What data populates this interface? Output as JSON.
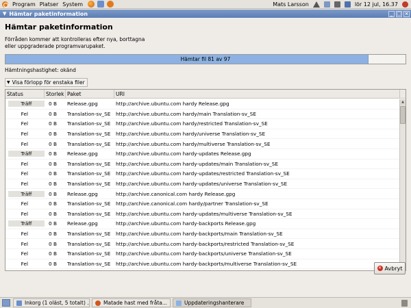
{
  "top_panel": {
    "menus": [
      "Program",
      "Platser",
      "System"
    ],
    "user": "Mats Larsson",
    "datetime": "lör 12 jul, 16.37"
  },
  "window": {
    "title": "Hämtar paketinformation",
    "heading": "Hämtar paketinformation",
    "description_line1": "Förråden kommer att kontrolleras efter nya, borttagna",
    "description_line2": "eller uppgraderade programvarupaket.",
    "progress_text": "Hämtar fil 81 av 97",
    "progress_fraction": 0.908,
    "speed": "Hämtningshastighet: okänd",
    "expander": "Visa förlopp för enstaka filer",
    "cancel": "Avbryt"
  },
  "table": {
    "headers": [
      "Status",
      "Storlek",
      "Paket",
      "URI"
    ],
    "rows": [
      {
        "status": "Träff",
        "size": "0 B",
        "pkg": "Release.gpg",
        "uri": "http://archive.ubuntu.com hardy Release.gpg"
      },
      {
        "status": "Fel",
        "size": "0 B",
        "pkg": "Translation-sv_SE",
        "uri": "http://archive.ubuntu.com hardy/main Translation-sv_SE"
      },
      {
        "status": "Fel",
        "size": "0 B",
        "pkg": "Translation-sv_SE",
        "uri": "http://archive.ubuntu.com hardy/restricted Translation-sv_SE"
      },
      {
        "status": "Fel",
        "size": "0 B",
        "pkg": "Translation-sv_SE",
        "uri": "http://archive.ubuntu.com hardy/universe Translation-sv_SE"
      },
      {
        "status": "Fel",
        "size": "0 B",
        "pkg": "Translation-sv_SE",
        "uri": "http://archive.ubuntu.com hardy/multiverse Translation-sv_SE"
      },
      {
        "status": "Träff",
        "size": "0 B",
        "pkg": "Release.gpg",
        "uri": "http://archive.ubuntu.com hardy-updates Release.gpg"
      },
      {
        "status": "Fel",
        "size": "0 B",
        "pkg": "Translation-sv_SE",
        "uri": "http://archive.ubuntu.com hardy-updates/main Translation-sv_SE"
      },
      {
        "status": "Fel",
        "size": "0 B",
        "pkg": "Translation-sv_SE",
        "uri": "http://archive.ubuntu.com hardy-updates/restricted Translation-sv_SE"
      },
      {
        "status": "Fel",
        "size": "0 B",
        "pkg": "Translation-sv_SE",
        "uri": "http://archive.ubuntu.com hardy-updates/universe Translation-sv_SE"
      },
      {
        "status": "Träff",
        "size": "0 B",
        "pkg": "Release.gpg",
        "uri": "http://archive.canonical.com hardy Release.gpg"
      },
      {
        "status": "Fel",
        "size": "0 B",
        "pkg": "Translation-sv_SE",
        "uri": "http://archive.canonical.com hardy/partner Translation-sv_SE"
      },
      {
        "status": "Fel",
        "size": "0 B",
        "pkg": "Translation-sv_SE",
        "uri": "http://archive.ubuntu.com hardy-updates/multiverse Translation-sv_SE"
      },
      {
        "status": "Träff",
        "size": "0 B",
        "pkg": "Release.gpg",
        "uri": "http://archive.ubuntu.com hardy-backports Release.gpg"
      },
      {
        "status": "Fel",
        "size": "0 B",
        "pkg": "Translation-sv_SE",
        "uri": "http://archive.ubuntu.com hardy-backports/main Translation-sv_SE"
      },
      {
        "status": "Fel",
        "size": "0 B",
        "pkg": "Translation-sv_SE",
        "uri": "http://archive.ubuntu.com hardy-backports/restricted Translation-sv_SE"
      },
      {
        "status": "Fel",
        "size": "0 B",
        "pkg": "Translation-sv_SE",
        "uri": "http://archive.ubuntu.com hardy-backports/universe Translation-sv_SE"
      },
      {
        "status": "Fel",
        "size": "0 B",
        "pkg": "Translation-sv_SE",
        "uri": "http://archive.ubuntu.com hardy-backports/multiverse Translation-sv_SE"
      }
    ]
  },
  "taskbar": {
    "tasks": [
      "Inkorg (1 oläst, 5 totalt) ...",
      "Matade hast med fråta...",
      "Uppdateringshanterare"
    ]
  },
  "colors": {
    "titlebar": "#5b7db4",
    "progress_fill": "#8cb1e2",
    "cancel_icon": "#cc2e22"
  },
  "icons": {
    "ubuntu": "ubuntu-logo-icon",
    "firefox": "firefox-icon",
    "help": "help-icon",
    "warning": "warning-icon",
    "network": "network-icon",
    "volume": "volume-icon",
    "mail": "mail-icon",
    "cancel": "cancel-icon",
    "trash": "trash-icon"
  }
}
